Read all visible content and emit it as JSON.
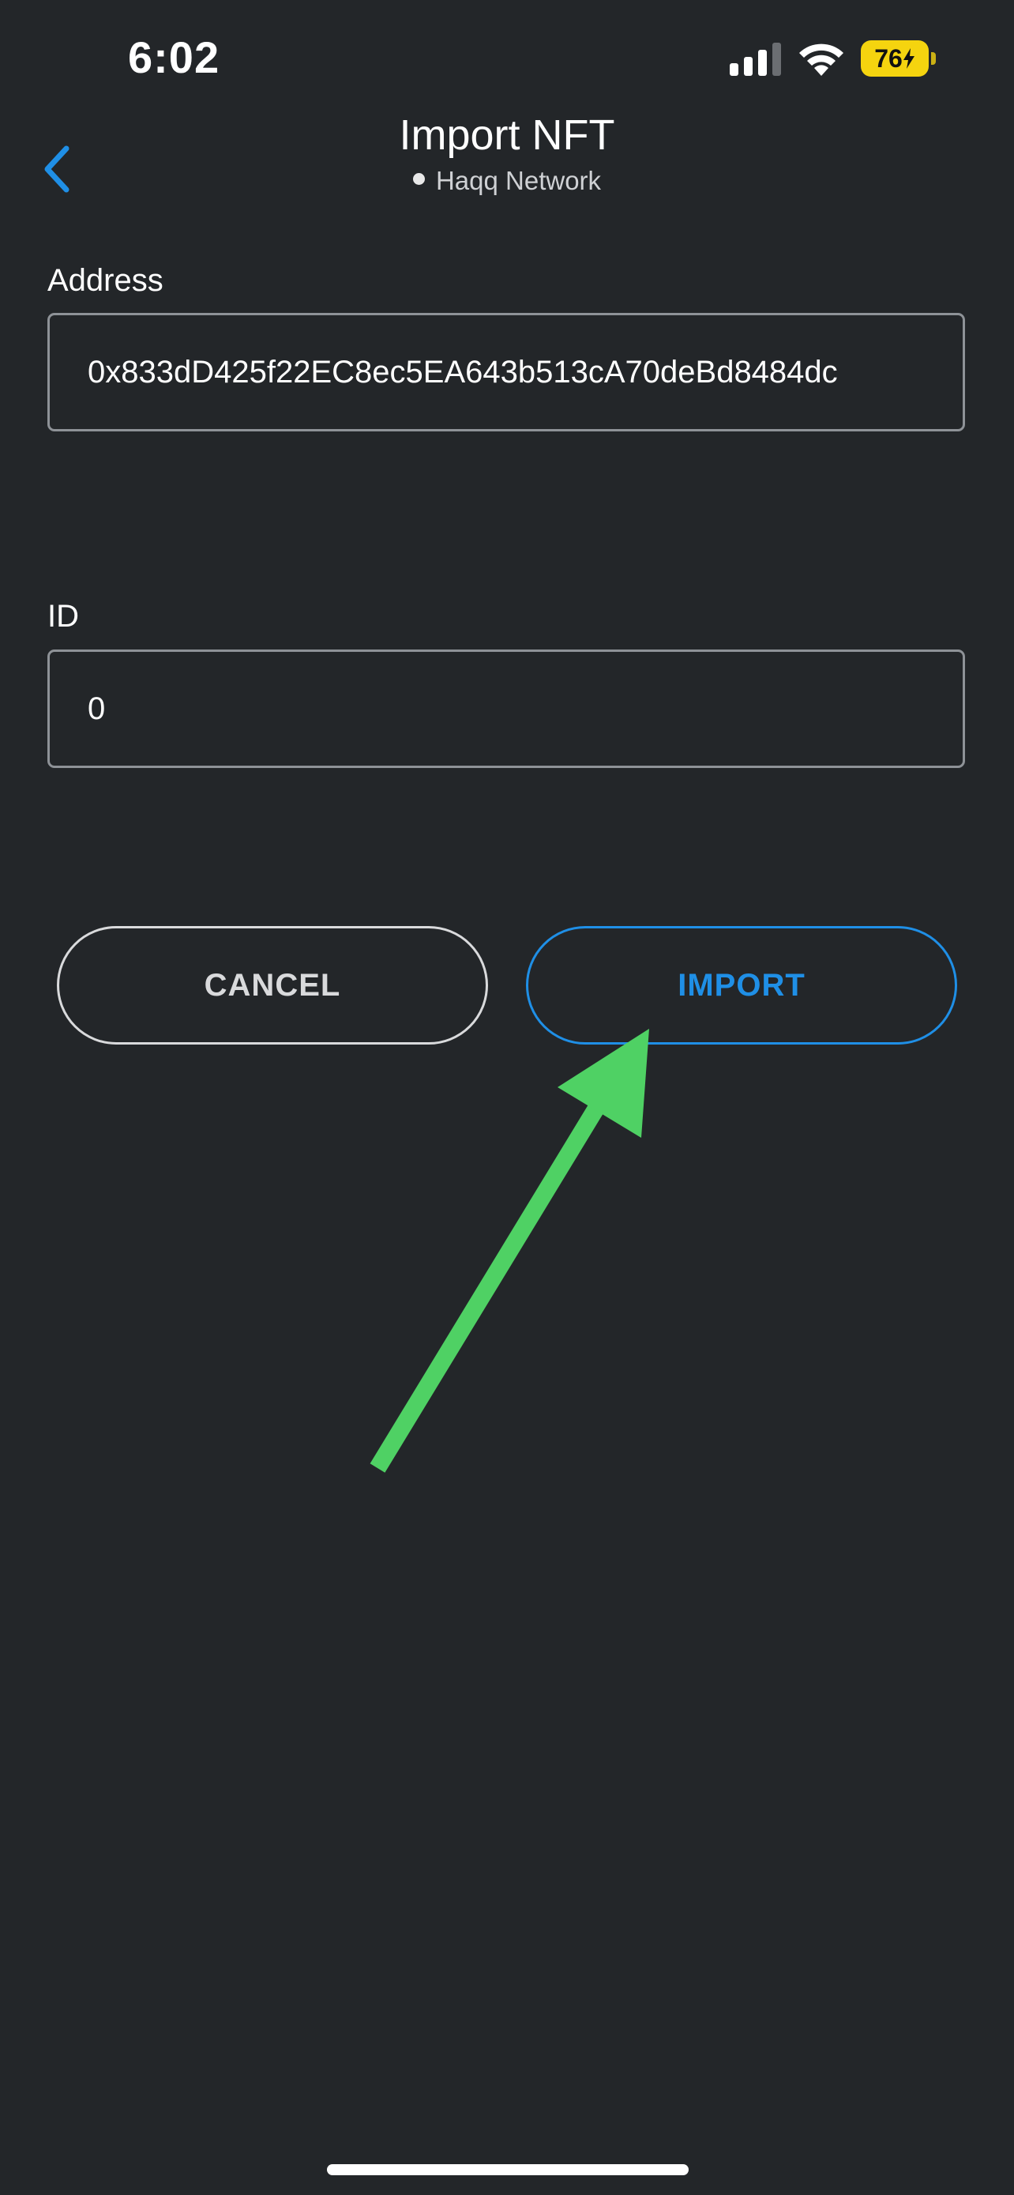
{
  "status_bar": {
    "time": "6:02",
    "battery_level": "76",
    "icons": [
      "signal-icon",
      "wifi-icon",
      "battery-charging-icon"
    ],
    "battery_color": "#f5d40f"
  },
  "header": {
    "title": "Import NFT",
    "network": "Haqq Network",
    "back_icon": "chevron-left-icon",
    "accent_color": "#1f8fe6"
  },
  "form": {
    "address": {
      "label": "Address",
      "value": "0x833dD425f22EC8ec5EA643b513cA70deBd8484dc"
    },
    "id": {
      "label": "ID",
      "value": "0"
    }
  },
  "actions": {
    "cancel_label": "CANCEL",
    "import_label": "IMPORT"
  },
  "annotation": {
    "type": "arrow",
    "color": "#4fd164",
    "points_to": "import-button"
  }
}
